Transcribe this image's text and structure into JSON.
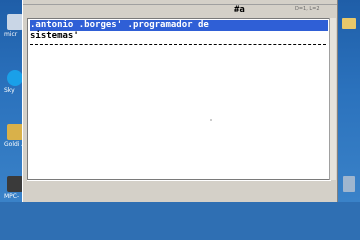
{
  "desktop": {
    "left_icons": [
      {
        "label": "micr",
        "icon": "computer-icon",
        "color": "#c9d6e6"
      },
      {
        "label": "Sky",
        "icon": "skype-icon",
        "color": "#1aa0e8"
      },
      {
        "label": "Goldi Atal",
        "icon": "gold-app-icon",
        "color": "#d9b14a"
      },
      {
        "label": "MPC-",
        "icon": "media-player-icon",
        "color": "#3a3a3a"
      }
    ],
    "right_icons": [
      {
        "icon": "folder-icon",
        "color": "#e9c86a"
      },
      {
        "icon": "recycle-bin-icon",
        "color": "#9fb6cf"
      }
    ]
  },
  "editor": {
    "header_marker": "#a",
    "ruler_text": "D=1, L=2",
    "lines": [
      {
        "text": ".antonio .borges' .programador de",
        "selected": true
      },
      {
        "text": "sistemas'",
        "selected": false
      }
    ]
  }
}
